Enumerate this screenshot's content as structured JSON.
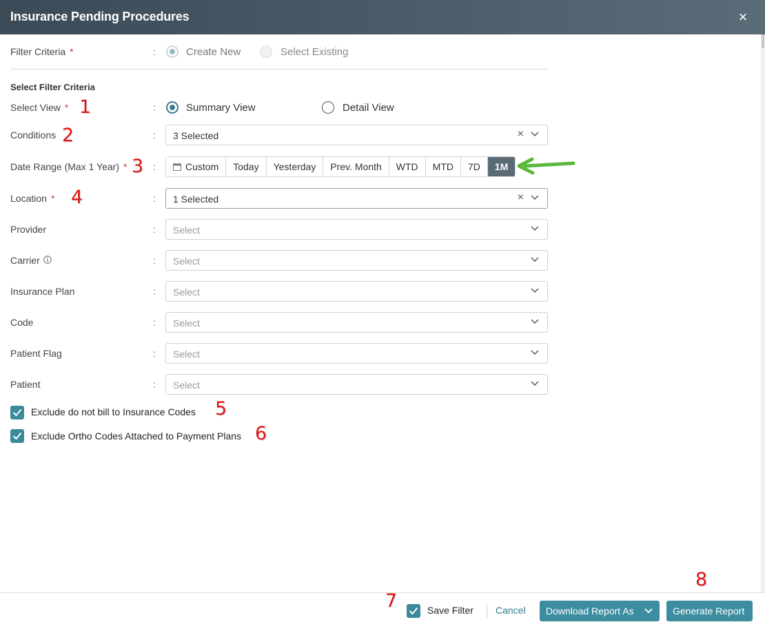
{
  "header": {
    "title": "Insurance Pending Procedures",
    "close": "×"
  },
  "filter_criteria": {
    "label": "Filter Criteria",
    "required_mark": "*",
    "options": [
      "Create New",
      "Select Existing"
    ],
    "selected": "Create New"
  },
  "section_title": "Select Filter Criteria",
  "select_view": {
    "label": "Select View",
    "required_mark": "*",
    "options": [
      "Summary View",
      "Detail View"
    ],
    "selected": "Summary View"
  },
  "conditions": {
    "label": "Conditions",
    "value": "3 Selected",
    "clear": "×"
  },
  "date_range": {
    "label": "Date Range (Max 1 Year)",
    "required_mark": "*",
    "options": [
      "Custom",
      "Today",
      "Yesterday",
      "Prev. Month",
      "WTD",
      "MTD",
      "7D",
      "1M"
    ],
    "selected": "1M"
  },
  "location": {
    "label": "Location",
    "required_mark": "*",
    "value": "1 Selected",
    "clear": "×"
  },
  "provider": {
    "label": "Provider",
    "placeholder": "Select"
  },
  "carrier": {
    "label": "Carrier",
    "placeholder": "Select"
  },
  "insurance_plan": {
    "label": "Insurance Plan",
    "placeholder": "Select"
  },
  "code": {
    "label": "Code",
    "placeholder": "Select"
  },
  "patient_flag": {
    "label": "Patient Flag",
    "placeholder": "Select"
  },
  "patient": {
    "label": "Patient",
    "placeholder": "Select"
  },
  "colon": ":",
  "checkboxes": [
    {
      "label": "Exclude do not bill to Insurance Codes",
      "checked": true
    },
    {
      "label": "Exclude Ortho Codes Attached to Payment Plans",
      "checked": true
    }
  ],
  "annotations": [
    "1",
    "2",
    "3",
    "4",
    "5",
    "6",
    "7",
    "8"
  ],
  "footer": {
    "save_filter_label": "Save Filter",
    "save_filter_checked": true,
    "cancel_label": "Cancel",
    "download_label": "Download Report As",
    "generate_label": "Generate Report"
  },
  "colors": {
    "accent": "#3c8da0",
    "header": "#4a5a66",
    "active_segment": "#5b6b76",
    "annotation": "#dd1111",
    "arrow": "#5cb83c"
  }
}
